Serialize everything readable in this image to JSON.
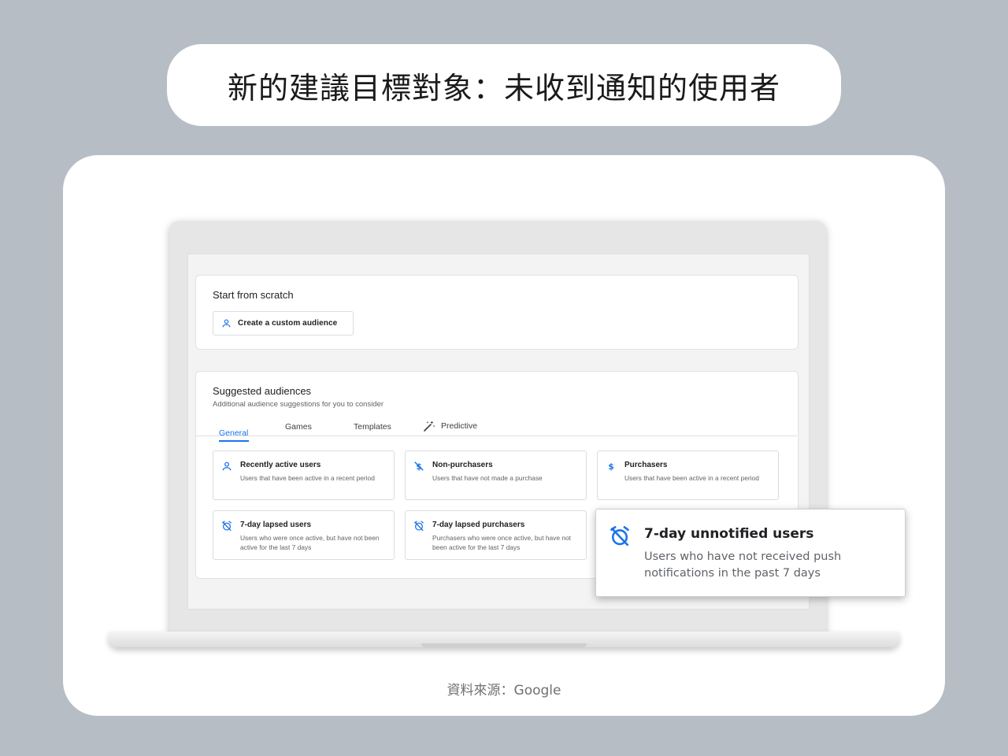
{
  "header": {
    "title": "新的建議目標對象：未收到通知的使用者"
  },
  "footer": {
    "source": "資料來源：Google"
  },
  "colors": {
    "accent": "#1a73e8",
    "background": "#b7bdc5"
  },
  "scratch": {
    "title": "Start from scratch",
    "button_label": "Create a custom audience",
    "button_icon": "person-icon"
  },
  "suggested": {
    "title": "Suggested audiences",
    "subtitle": "Additional audience suggestions for you to consider",
    "tabs": [
      {
        "label": "General",
        "active": true
      },
      {
        "label": "Games",
        "active": false
      },
      {
        "label": "Templates",
        "active": false
      },
      {
        "label": "Predictive",
        "active": false,
        "icon": "magic-wand-icon"
      }
    ],
    "audiences": [
      {
        "title": "Recently active users",
        "desc": "Users that have been active in a recent period",
        "icon": "person-icon"
      },
      {
        "title": "Non-purchasers",
        "desc": "Users that have not made a purchase",
        "icon": "no-dollar-icon"
      },
      {
        "title": "Purchasers",
        "desc": "Users that have been active in a recent period",
        "icon": "dollar-icon"
      },
      {
        "title": "7-day lapsed users",
        "desc": "Users who were once active, but have not been active for the last 7 days",
        "icon": "alarm-off-icon"
      },
      {
        "title": "7-day lapsed purchasers",
        "desc": "Purchasers who were once active, but have not been active for the last 7 days",
        "icon": "alarm-off-icon"
      }
    ]
  },
  "highlight": {
    "title": "7-day unnotified users",
    "desc": "Users who have not received push notifications in the past 7 days",
    "icon": "alarm-off-icon"
  }
}
